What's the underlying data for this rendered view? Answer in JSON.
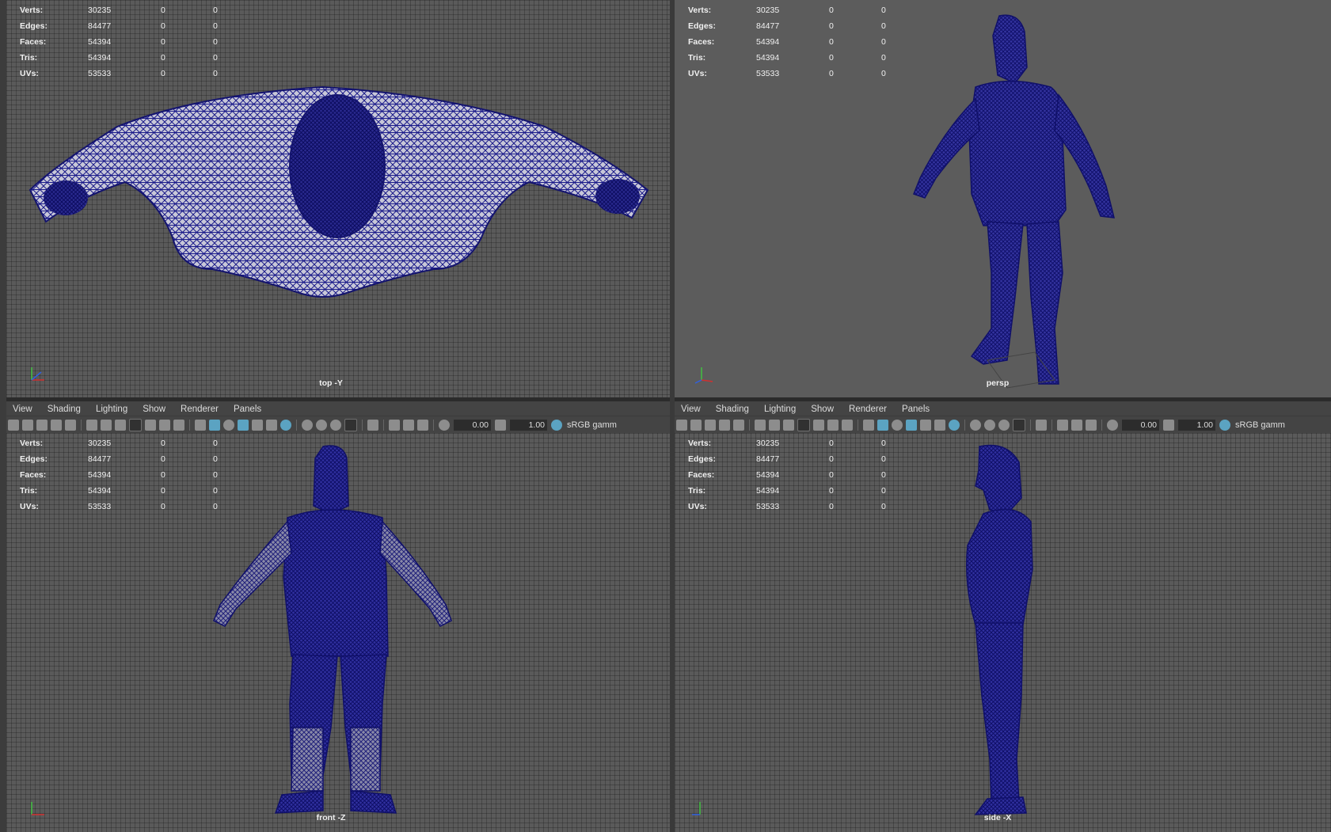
{
  "hud": {
    "labels": [
      "Verts:",
      "Edges:",
      "Faces:",
      "Tris:",
      "UVs:"
    ],
    "values": [
      [
        "30235",
        "0",
        "0"
      ],
      [
        "84477",
        "0",
        "0"
      ],
      [
        "54394",
        "0",
        "0"
      ],
      [
        "54394",
        "0",
        "0"
      ],
      [
        "53533",
        "0",
        "0"
      ]
    ]
  },
  "viewports": {
    "top": {
      "camera": "top -Y"
    },
    "persp": {
      "camera": "persp"
    },
    "front": {
      "camera": "front -Z"
    },
    "side": {
      "camera": "side -X"
    }
  },
  "panel_menu": [
    "View",
    "Shading",
    "Lighting",
    "Show",
    "Renderer",
    "Panels"
  ],
  "toolbar": {
    "exposure": "0.00",
    "gamma": "1.00",
    "color_space": "sRGB gamm"
  },
  "colors": {
    "wire": "#1a1a8a",
    "viewport_bg": "#5a5a5a",
    "axis_x": "#d03030",
    "axis_y": "#40c040",
    "axis_z": "#3060e0"
  }
}
